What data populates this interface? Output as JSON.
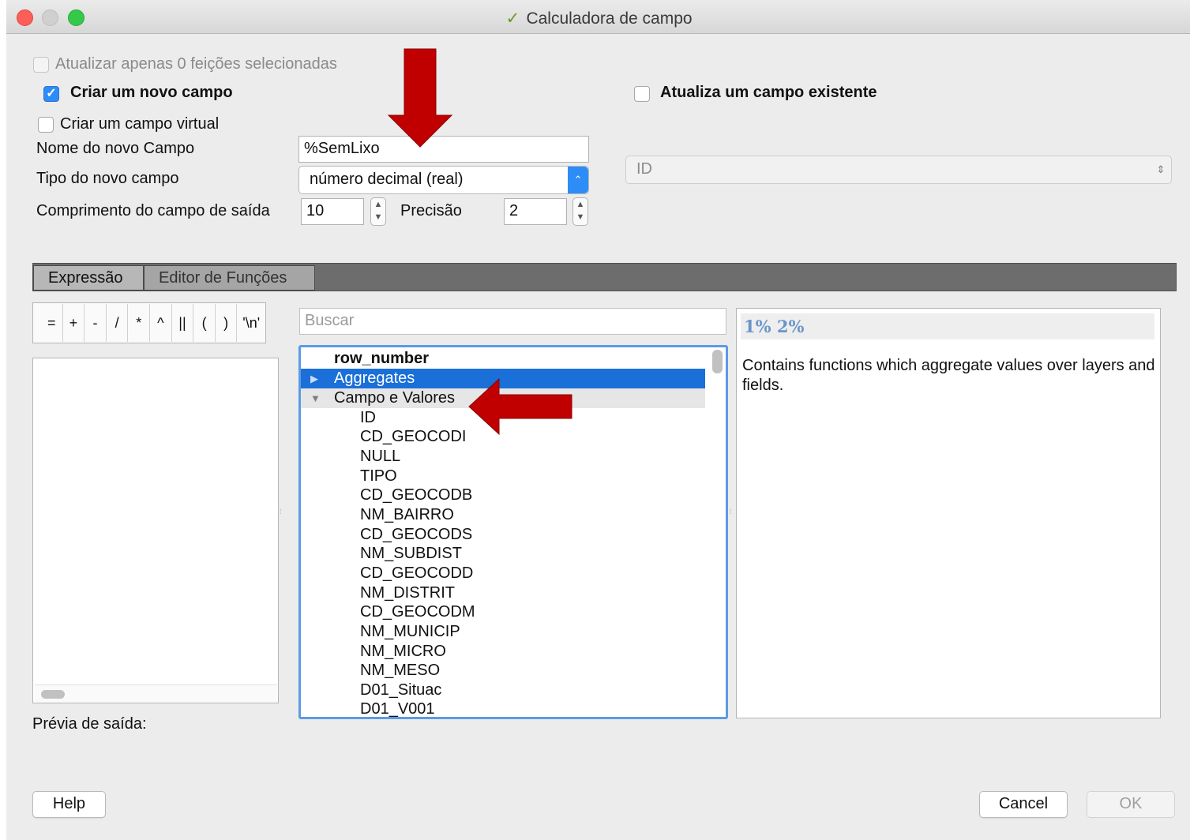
{
  "window": {
    "title": "Calculadora de campo",
    "app_icon": "qgis-icon"
  },
  "options": {
    "update_selected_label": "Atualizar apenas 0 feições selecionadas",
    "create_new_field_label": "Criar um novo campo",
    "create_new_field_checked": true,
    "update_existing_label": "Atualiza um campo existente",
    "create_virtual_label": "Criar um campo virtual"
  },
  "new_field": {
    "name_label": "Nome do novo Campo",
    "name_value": "%SemLixo",
    "type_label": "Tipo do novo campo",
    "type_value": "número decimal (real)",
    "length_label": "Comprimento do campo de saída",
    "length_value": "10",
    "precision_label": "Precisão",
    "precision_value": "2"
  },
  "existing_field": {
    "selected": "ID"
  },
  "tabs": [
    {
      "label": "Expressão",
      "active": true
    },
    {
      "label": "Editor de Funções",
      "active": false
    }
  ],
  "operators": [
    "=",
    "+",
    "-",
    "/",
    "*",
    "^",
    "||",
    "(",
    ")",
    "'\\n'"
  ],
  "search": {
    "placeholder": "Buscar"
  },
  "function_tree": {
    "items": [
      {
        "label": "row_number",
        "kind": "function",
        "bold": true
      },
      {
        "label": "Aggregates",
        "kind": "group",
        "expanded": false,
        "selected": true
      },
      {
        "label": "Campo e Valores",
        "kind": "group",
        "expanded": true
      },
      {
        "label": "ID",
        "kind": "field"
      },
      {
        "label": "CD_GEOCODI",
        "kind": "field"
      },
      {
        "label": "NULL",
        "kind": "field"
      },
      {
        "label": "TIPO",
        "kind": "field"
      },
      {
        "label": "CD_GEOCODB",
        "kind": "field"
      },
      {
        "label": "NM_BAIRRO",
        "kind": "field"
      },
      {
        "label": "CD_GEOCODS",
        "kind": "field"
      },
      {
        "label": "NM_SUBDIST",
        "kind": "field"
      },
      {
        "label": "CD_GEOCODD",
        "kind": "field"
      },
      {
        "label": "NM_DISTRIT",
        "kind": "field"
      },
      {
        "label": "CD_GEOCODM",
        "kind": "field"
      },
      {
        "label": "NM_MUNICIP",
        "kind": "field"
      },
      {
        "label": "NM_MICRO",
        "kind": "field"
      },
      {
        "label": "NM_MESO",
        "kind": "field"
      },
      {
        "label": "D01_Situac",
        "kind": "field"
      },
      {
        "label": "D01_V001",
        "kind": "field"
      }
    ]
  },
  "help": {
    "title": "1% 2%",
    "text": "Contains functions which aggregate values over layers and fields."
  },
  "preview": {
    "label": "Prévia de saída:"
  },
  "buttons": {
    "help": "Help",
    "cancel": "Cancel",
    "ok": "OK"
  },
  "colors": {
    "accent": "#2e8cf6",
    "selection": "#1a6fd8",
    "annotation_arrow": "#c00000"
  }
}
